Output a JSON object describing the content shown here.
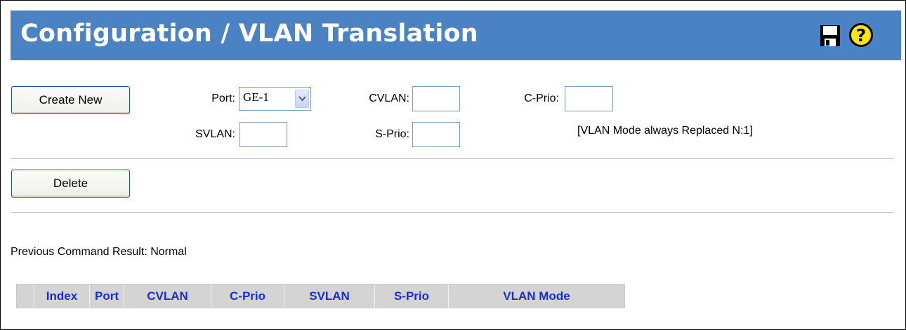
{
  "header": {
    "title": "Configuration / VLAN Translation",
    "icons": {
      "save": "floppy-disk-icon",
      "help": "question-mark-icon"
    },
    "color": "#4a82c4"
  },
  "form": {
    "create_button": "Create New",
    "port_label": "Port:",
    "port_value": "GE-1",
    "cvlan_label": "CVLAN:",
    "cvlan_value": "",
    "cprio_label": "C-Prio:",
    "cprio_value": "",
    "svlan_label": "SVLAN:",
    "svlan_value": "",
    "sprio_label": "S-Prio:",
    "sprio_value": "",
    "mode_note": "[VLAN Mode always Replaced N:1]"
  },
  "delete_button": "Delete",
  "status": {
    "result_text": "Previous Command Result: Normal"
  },
  "table": {
    "columns": [
      "",
      "Index",
      "Port",
      "CVLAN",
      "C-Prio",
      "SVLAN",
      "S-Prio",
      "VLAN Mode"
    ],
    "rows": [],
    "header_text_color": "#1730cc"
  }
}
